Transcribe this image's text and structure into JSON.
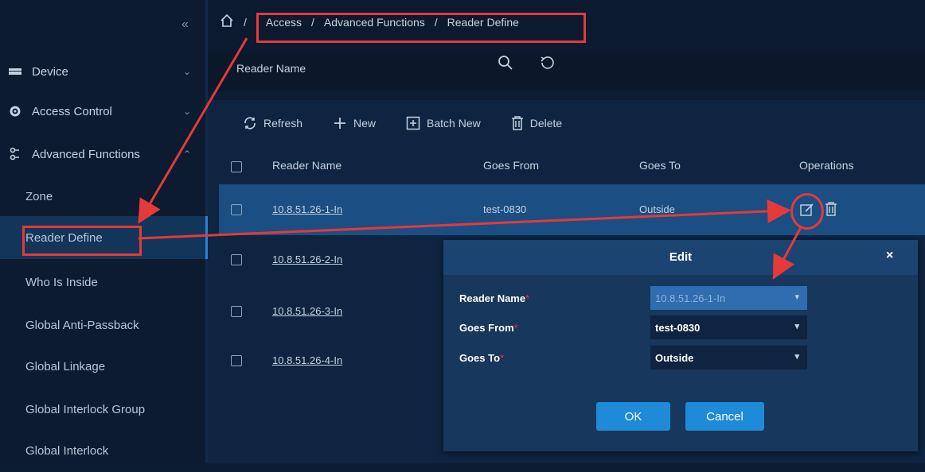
{
  "sidebar": {
    "collapse_glyph": "«",
    "groups": [
      {
        "label": "Device",
        "icon": "device-icon",
        "chevron": "⌄"
      },
      {
        "label": "Access Control",
        "icon": "gear-icon",
        "chevron": "⌄"
      },
      {
        "label": "Advanced Functions",
        "icon": "advanced-icon",
        "chevron": "⌃"
      }
    ],
    "items": [
      {
        "label": "Zone"
      },
      {
        "label": "Reader Define"
      },
      {
        "label": "Who Is Inside"
      },
      {
        "label": "Global Anti-Passback"
      },
      {
        "label": "Global Linkage"
      },
      {
        "label": "Global Interlock Group"
      },
      {
        "label": "Global Interlock"
      }
    ],
    "active_item": "Reader Define"
  },
  "breadcrumb": {
    "home_icon": "home-icon",
    "sep": "/",
    "items": [
      "Access",
      "Advanced Functions",
      "Reader Define"
    ]
  },
  "search": {
    "placeholder": "Reader Name"
  },
  "toolbar": {
    "refresh": "Refresh",
    "new": "New",
    "batch_new": "Batch New",
    "delete": "Delete"
  },
  "table": {
    "headers": [
      "Reader Name",
      "Goes From",
      "Goes To",
      "Operations"
    ],
    "rows": [
      {
        "name": "10.8.51.26-1-In",
        "from": "test-0830",
        "to": "Outside"
      },
      {
        "name": "10.8.51.26-2-In",
        "from": "",
        "to": ""
      },
      {
        "name": "10.8.51.26-3-In",
        "from": "",
        "to": ""
      },
      {
        "name": "10.8.51.26-4-In",
        "from": "",
        "to": ""
      }
    ]
  },
  "dialog": {
    "title": "Edit",
    "close": "×",
    "required_mark": "*",
    "fields": [
      {
        "label": "Reader Name",
        "value": "10.8.51.26-1-In"
      },
      {
        "label": "Goes From",
        "value": "test-0830"
      },
      {
        "label": "Goes To",
        "value": "Outside"
      }
    ],
    "ok": "OK",
    "cancel": "Cancel"
  },
  "colors": {
    "accent": "#1e8ad8",
    "annotation": "#e43a3a",
    "selected_row": "#1b4e83"
  }
}
